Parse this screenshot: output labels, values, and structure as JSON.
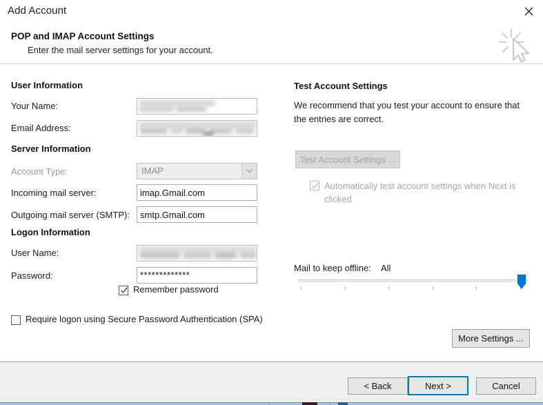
{
  "window": {
    "title": "Add Account",
    "close_icon": "close-icon"
  },
  "header": {
    "title": "POP and IMAP Account Settings",
    "subtitle": "Enter the mail server settings for your account.",
    "icon": "cursor-sparkle-icon"
  },
  "left": {
    "user_information": {
      "heading": "User Information",
      "fields": [
        {
          "label": "Your Name:",
          "value": "",
          "redacted": true
        },
        {
          "label": "Email Address:",
          "value": "",
          "redacted": true
        }
      ]
    },
    "server_information": {
      "heading": "Server Information",
      "account_type": {
        "label": "Account Type:",
        "value": "IMAP",
        "disabled": true,
        "arrow_icon": "chevron-down-icon"
      },
      "incoming": {
        "label": "Incoming mail server:",
        "value": "imap.Gmail.com"
      },
      "outgoing": {
        "label": "Outgoing mail server (SMTP):",
        "value": "smtp.Gmail.com"
      }
    },
    "logon_information": {
      "heading": "Logon Information",
      "user_name": {
        "label": "User Name:",
        "value": "",
        "redacted": true
      },
      "password": {
        "label": "Password:",
        "value": "*************"
      },
      "remember_password": {
        "label": "Remember password",
        "checked": true
      },
      "require_spa": {
        "label": "Require logon using Secure Password Authentication (SPA)",
        "checked": false
      }
    }
  },
  "right": {
    "heading": "Test Account Settings",
    "description": "We recommend that you test your account to ensure that the entries are correct.",
    "test_button": {
      "label": "Test Account Settings ...",
      "disabled": true
    },
    "auto_test": {
      "label": "Automatically test account settings when Next is clicked",
      "checked": true,
      "disabled": true
    },
    "mail_offline": {
      "label": "Mail to keep offline:",
      "value": "All",
      "slider_position_percent": 100,
      "tick_count": 6
    },
    "more_settings_button": {
      "label": "More Settings ..."
    }
  },
  "footer": {
    "back_button": "< Back",
    "next_button": "Next >",
    "cancel_button": "Cancel",
    "default_button": "Next >"
  },
  "colors": {
    "accent": "#0b76ad",
    "slider_thumb": "#0078d7",
    "dialog_bg": "#ffffff",
    "footer_bg": "#f0f0f0"
  }
}
